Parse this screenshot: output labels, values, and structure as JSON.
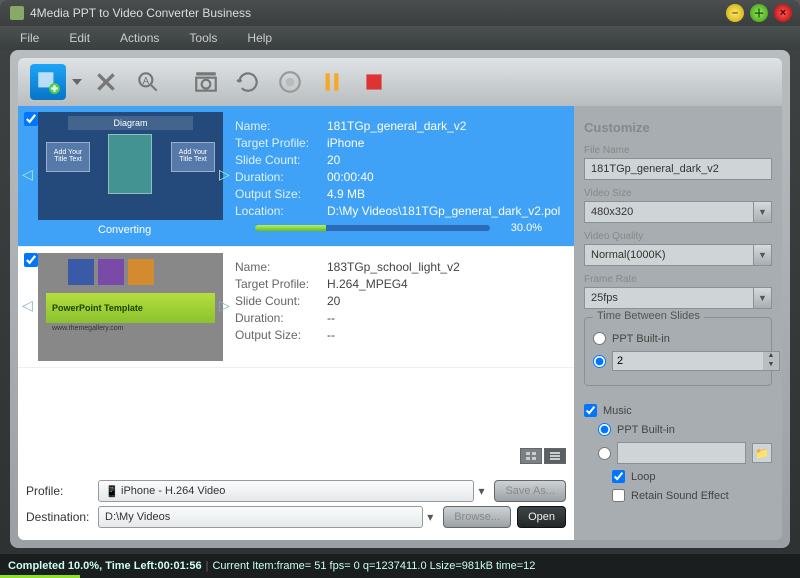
{
  "app": {
    "title": "4Media PPT to Video Converter Business"
  },
  "menu": {
    "file": "File",
    "edit": "Edit",
    "actions": "Actions",
    "tools": "Tools",
    "help": "Help"
  },
  "items": [
    {
      "thumb_caption": "Diagram",
      "thumb_box": "Add Your Title Text",
      "name": "181TGp_general_dark_v2",
      "profile": "iPhone",
      "slides": "20",
      "duration": "00:00:40",
      "size": "4.9 MB",
      "location": "D:\\My Videos\\181TGp_general_dark_v2.pol",
      "status": "Converting",
      "progress_pct": 30,
      "progress_label": "30.0%"
    },
    {
      "thumb_caption": "PowerPoint Template",
      "thumb_sub": "www.themegallery.com",
      "name": "183TGp_school_light_v2",
      "profile": "H.264_MPEG4",
      "slides": "20",
      "duration": "--",
      "size": "--"
    }
  ],
  "labels": {
    "name": "Name:",
    "profile": "Target Profile:",
    "slides": "Slide Count:",
    "duration": "Duration:",
    "size": "Output Size:",
    "location": "Location:"
  },
  "bottom": {
    "profile_label": "Profile:",
    "profile_value": "iPhone - H.264 Video",
    "dest_label": "Destination:",
    "dest_value": "D:\\My Videos",
    "save_as": "Save As...",
    "browse": "Browse...",
    "open": "Open"
  },
  "customize": {
    "title": "Customize",
    "file_name_label": "File Name",
    "file_name": "181TGp_general_dark_v2",
    "size_label": "Video Size",
    "size_value": "480x320",
    "quality_label": "Video Quality",
    "quality_value": "Normal(1000K)",
    "fps_label": "Frame Rate",
    "fps_value": "25fps",
    "time_group": "Time Between Slides",
    "ppt_builtin": "PPT Built-in",
    "spin_value": "2",
    "music": "Music",
    "loop": "Loop",
    "retain": "Retain Sound Effect"
  },
  "status": {
    "completed": "Completed 10.0%, Time Left:00:01:56",
    "current": "Current Item:frame= 51 fps= 0 q=1237411.0 Lsize=981kB time=12",
    "progress_pct": 10
  }
}
